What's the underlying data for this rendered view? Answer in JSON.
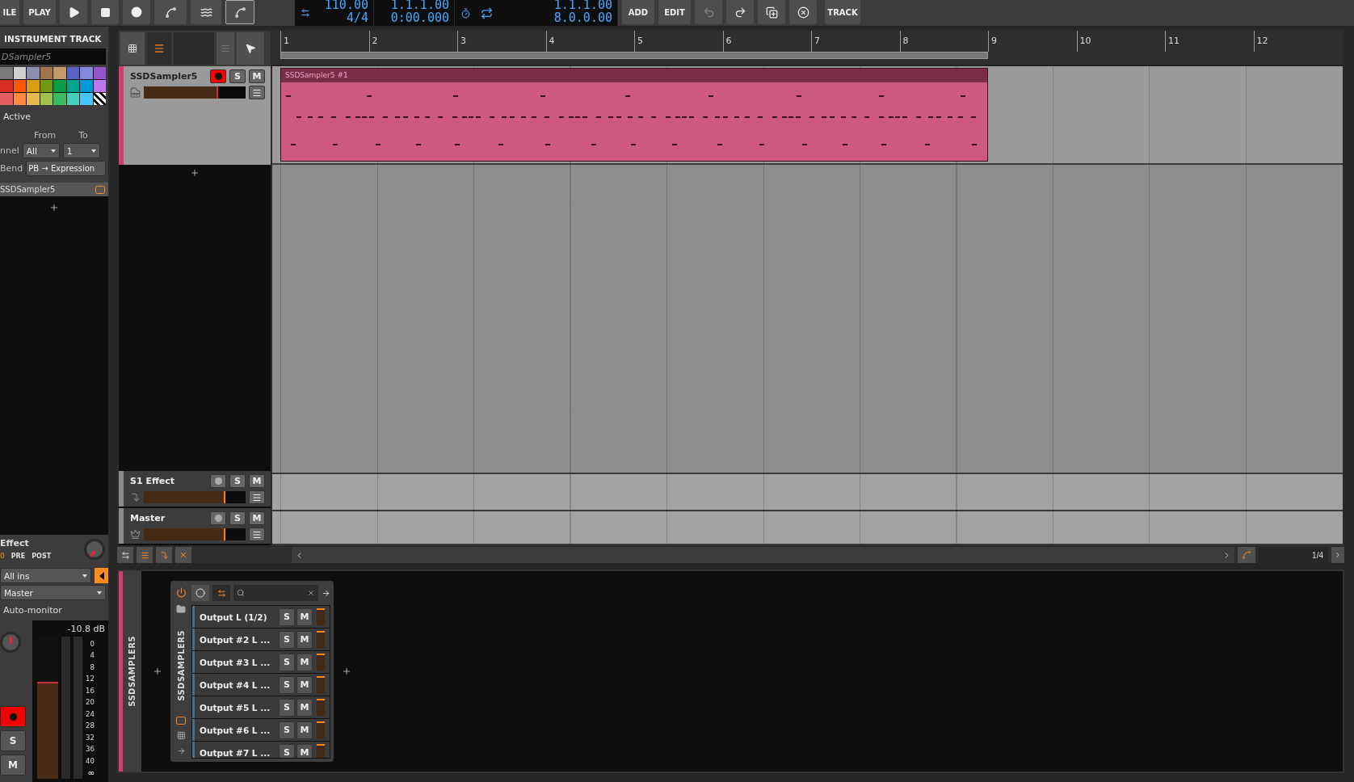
{
  "toolbar": {
    "left_labels": [
      "ILE",
      "PLAY"
    ],
    "tempo": "110.00",
    "time_signature": "4/4",
    "position_beats": "1.1.1.00",
    "position_time": "0:00.000",
    "loop_start": "1.1.1.00",
    "loop_length": "8.0.0.00",
    "right_labels": [
      "ADD",
      "EDIT",
      "TRACK"
    ]
  },
  "inspector": {
    "title": "INSTRUMENT TRACK",
    "track_name": "DSampler5",
    "palette": [
      {
        "kind": "swatch",
        "color": "#7a7a7a"
      },
      {
        "kind": "swatch",
        "color": "#cfcfcf"
      },
      {
        "kind": "swatch",
        "color": "#8a8cb0"
      },
      {
        "kind": "swatch",
        "color": "#a47449"
      },
      {
        "kind": "swatch",
        "color": "#c4996c"
      },
      {
        "kind": "swatch",
        "color": "#5761c6"
      },
      {
        "kind": "swatch",
        "color": "#8489dd"
      },
      {
        "kind": "swatch",
        "color": "#9553cc"
      },
      {
        "kind": "swatch",
        "color": "#d92e24"
      },
      {
        "kind": "swatch",
        "color": "#ff5706"
      },
      {
        "kind": "swatch",
        "color": "#d99d10"
      },
      {
        "kind": "swatch",
        "color": "#739814"
      },
      {
        "kind": "swatch",
        "color": "#0a9c45"
      },
      {
        "kind": "swatch",
        "color": "#00a694"
      },
      {
        "kind": "swatch",
        "color": "#0099d9"
      },
      {
        "kind": "swatch",
        "color": "#bc76f0"
      },
      {
        "kind": "swatch",
        "color": "#e55f62"
      },
      {
        "kind": "swatch",
        "color": "#ff8a40"
      },
      {
        "kind": "swatch",
        "color": "#e4b94f"
      },
      {
        "kind": "swatch",
        "color": "#a0c14b"
      },
      {
        "kind": "swatch",
        "color": "#3dbb64"
      },
      {
        "kind": "swatch",
        "color": "#43d1bd"
      },
      {
        "kind": "swatch",
        "color": "#44c8ff"
      },
      {
        "kind": "none"
      }
    ],
    "active_label": "Active",
    "from_label": "From",
    "to_label": "To",
    "channel": {
      "label": "nnel",
      "from": "All",
      "to": "1"
    },
    "bend": {
      "label": "Bend",
      "value": "PB → Expression"
    },
    "device": "SSDSampler5",
    "send": {
      "label": "Effect",
      "amount": "0",
      "pre": "PRE",
      "post": "POST"
    },
    "input": "All ins",
    "output": "Master",
    "monitor_label": "Auto-monitor",
    "meter": {
      "reading": "-10.8 dB",
      "level": 0.68,
      "scale": [
        "0",
        "4",
        "8",
        "12",
        "16",
        "20",
        "24",
        "28",
        "32",
        "36",
        "40"
      ],
      "floor": "∞"
    },
    "armed": true,
    "solo": "S",
    "mute": "M"
  },
  "tracks": [
    {
      "kind": "instrument",
      "name": "SSDSampler5",
      "armed": true,
      "level": 0.73,
      "color": "#d63a6f",
      "solo": "S",
      "mute": "M"
    },
    {
      "kind": "effect",
      "name": "S1 Effect",
      "armed": false,
      "level": 0.8,
      "color": "#8a8a8a",
      "solo": "S",
      "mute": "M"
    },
    {
      "kind": "master",
      "name": "Master",
      "armed": false,
      "level": 0.8,
      "color": "#8a8a8a",
      "solo": "S",
      "mute": "M"
    }
  ],
  "ruler": [
    "1",
    "2",
    "3",
    "4",
    "5",
    "6",
    "7",
    "8",
    "9",
    "10",
    "11",
    "12"
  ],
  "clip": {
    "name": "SSDSampler5 #1"
  },
  "zoom_label": "1/4",
  "device_panel": {
    "track_label": "SSDSAMPLER5",
    "device_name": "SSDSAMPLER5",
    "enabled": true,
    "outputs": [
      {
        "name": "Output L (1/2)",
        "solo": "S",
        "mute": "M"
      },
      {
        "name": "Output #2 L ...",
        "solo": "S",
        "mute": "M"
      },
      {
        "name": "Output #3 L ...",
        "solo": "S",
        "mute": "M"
      },
      {
        "name": "Output #4 L ...",
        "solo": "S",
        "mute": "M"
      },
      {
        "name": "Output #5 L ...",
        "solo": "S",
        "mute": "M"
      },
      {
        "name": "Output #6 L ...",
        "solo": "S",
        "mute": "M"
      },
      {
        "name": "Output #7 L ...",
        "solo": "S",
        "mute": "M"
      }
    ]
  }
}
